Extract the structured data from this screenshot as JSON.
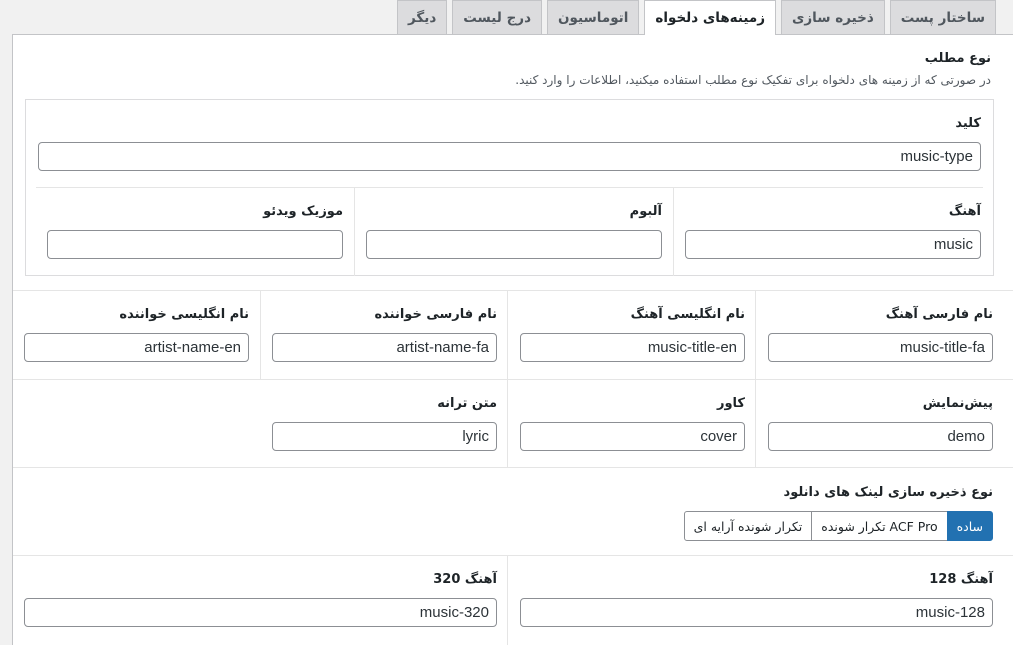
{
  "tabs": [
    "ساختار پست",
    "ذخیره سازی",
    "زمینه‌های دلخواه",
    "اتوماسیون",
    "درج لیست",
    "دیگر"
  ],
  "post_type": {
    "title": "نوع مطلب",
    "description": "در صورتی که از زمینه های دلخواه برای تفکیک نوع مطلب استفاده میکنید، اطلاعات را وارد کنید.",
    "key_label": "کلید",
    "key_value": "music-type",
    "fields": [
      {
        "label": "آهنگ",
        "value": "music"
      },
      {
        "label": "آلبوم",
        "value": ""
      },
      {
        "label": "موزیک ویدئو",
        "value": ""
      }
    ]
  },
  "meta_row1": [
    {
      "label": "نام فارسی آهنگ",
      "value": "music-title-fa"
    },
    {
      "label": "نام انگلیسی آهنگ",
      "value": "music-title-en"
    },
    {
      "label": "نام فارسی خواننده",
      "value": "artist-name-fa"
    },
    {
      "label": "نام انگلیسی خواننده",
      "value": "artist-name-en"
    }
  ],
  "meta_row2": [
    {
      "label": "پیش‌نمایش",
      "value": "demo"
    },
    {
      "label": "کاور",
      "value": "cover"
    },
    {
      "label": "متن ترانه",
      "value": "lyric"
    }
  ],
  "download_links": {
    "title": "نوع ذخیره سازی لینک های دانلود",
    "options": [
      "ساده",
      "تکرار شونده ACF Pro",
      "تکرار شونده آرایه ای"
    ],
    "selected": "ساده"
  },
  "quality_row": [
    {
      "label": "آهنگ 128",
      "value": "music-128"
    },
    {
      "label": "آهنگ 320",
      "value": "music-320"
    }
  ],
  "colors": {
    "accent": "#2271b1",
    "tab_inactive": "#dcdcde",
    "border": "#c3c4c7"
  }
}
